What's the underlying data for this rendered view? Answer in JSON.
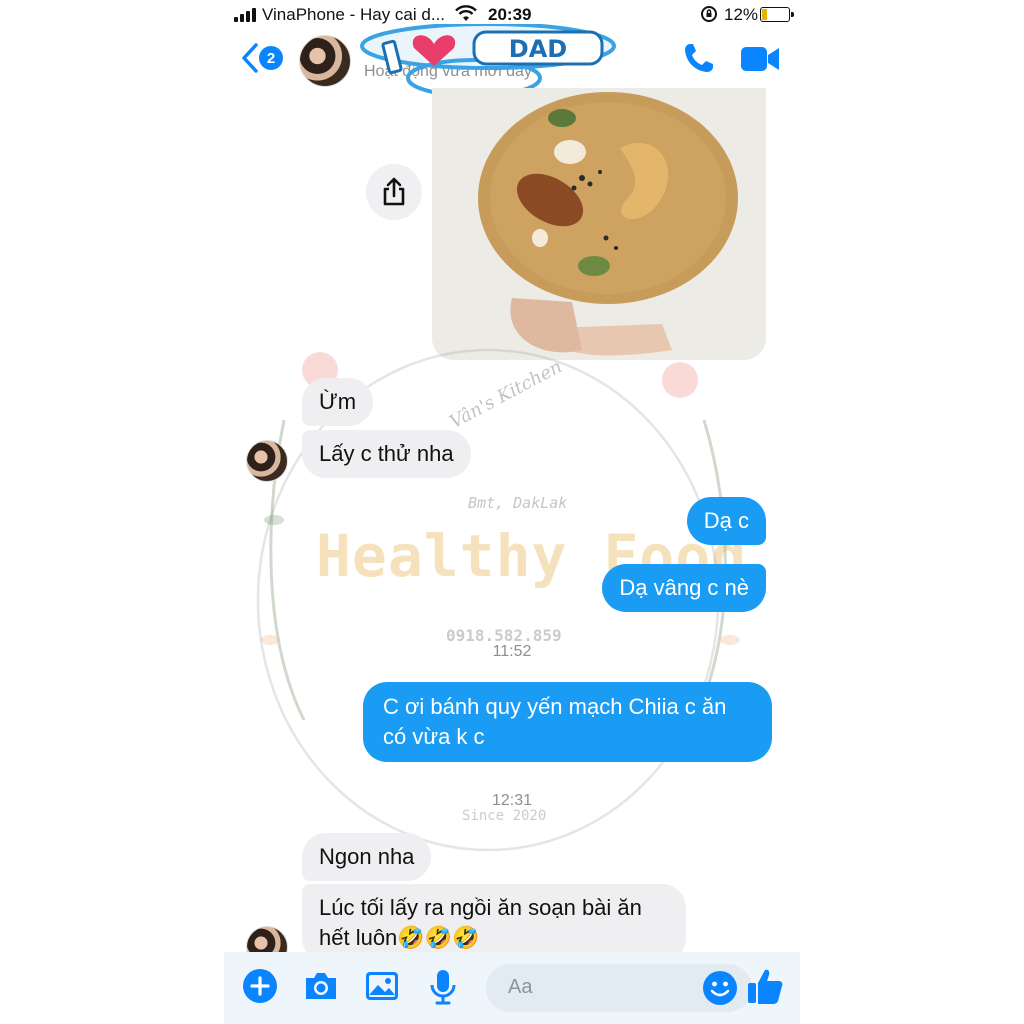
{
  "status_bar": {
    "carrier": "VinaPhone - Hay cai d...",
    "time": "20:39",
    "battery": "12%",
    "icons": [
      "signal-icon",
      "wifi-icon",
      "orientation-lock-icon",
      "battery-icon"
    ]
  },
  "header": {
    "back_count": "2",
    "subtitle": "Hoạt động vừa mới đây",
    "sticker_text": "DAD",
    "icons": [
      "back-chevron-icon",
      "phone-icon",
      "video-icon"
    ]
  },
  "messages": [
    {
      "side": "in",
      "text": "Ừm"
    },
    {
      "side": "in",
      "text": "Lấy c thử nha"
    },
    {
      "side": "out",
      "text": "Dạ c"
    },
    {
      "side": "out",
      "text": "Dạ vâng c nè"
    },
    {
      "side": "out",
      "text": "C ơi bánh quy yến mạch Chiia c ăn có vừa k c",
      "line1": "C ơi bánh quy yến mạch Chiia c ăn",
      "line2": "có vừa k c"
    },
    {
      "side": "in",
      "text": "Ngon nha"
    },
    {
      "side": "in",
      "text": "Lúc tối lấy ra ngồi ăn soạn bài ăn hết luôn🤣🤣🤣",
      "line1": "Lúc tối lấy ra ngồi ăn soạn bài ăn",
      "line2": "hết luôn🤣🤣🤣"
    }
  ],
  "timestamps": [
    "11:52",
    "12:31"
  ],
  "watermark": {
    "title": "Healthy Food",
    "location": "Bmt, DakLak",
    "phone": "0918.582.859",
    "since": "Since 2020",
    "signature": "Vân's Kitchen"
  },
  "composer": {
    "placeholder": "Aa",
    "icons": [
      "plus-icon",
      "camera-icon",
      "image-icon",
      "microphone-icon",
      "emoji-icon",
      "thumbs-up-icon"
    ]
  },
  "colors": {
    "accent": "#0a84ff",
    "outgoing_bubble": "#1a9cf5",
    "incoming_bubble": "#efeff1"
  }
}
